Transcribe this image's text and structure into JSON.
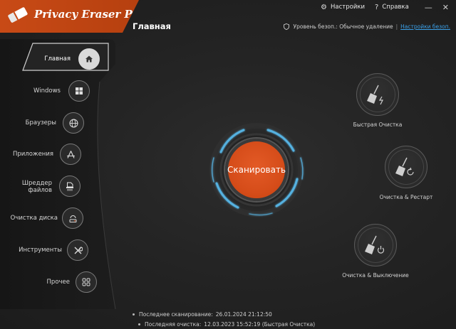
{
  "app": {
    "title": "Privacy Eraser Pro"
  },
  "topbar": {
    "settings_label": "Настройки",
    "help_label": "Справка",
    "minimize_glyph": "—",
    "close_glyph": "✕"
  },
  "page": {
    "title": "Главная"
  },
  "status": {
    "security_level": "Уровень безоп.: Обычное удаление",
    "separator": "|",
    "settings_link": "Настройки безоп."
  },
  "sidebar": {
    "items": [
      {
        "label": "Главная",
        "icon": "home-icon",
        "active": true
      },
      {
        "label": "Windows",
        "icon": "windows-icon"
      },
      {
        "label": "Браузеры",
        "icon": "globe-icon"
      },
      {
        "label": "Приложения",
        "icon": "apps-icon"
      },
      {
        "label_line1": "Шреддер",
        "label_line2": "файлов",
        "icon": "shredder-icon"
      },
      {
        "label": "Очистка диска",
        "icon": "disk-clean-icon"
      },
      {
        "label": "Инструменты",
        "icon": "tools-icon"
      },
      {
        "label": "Прочее",
        "icon": "grid-icon"
      }
    ]
  },
  "scan": {
    "label": "Сканировать"
  },
  "actions": [
    {
      "label": "Быстрая Очистка",
      "icon": "broom-lightning-icon"
    },
    {
      "label": "Очистка & Рестарт",
      "icon": "broom-restart-icon"
    },
    {
      "label": "Очистка & Выключение",
      "icon": "broom-power-icon"
    }
  ],
  "footer": {
    "last_scan_label": "Последнее сканирование:",
    "last_scan_value": "26.01.2024 21:12:50",
    "last_clean_label": "Последняя очистка:",
    "last_clean_value": "12.03.2023 15:52:19 (Быстрая Очистка)"
  },
  "colors": {
    "accent": "#d64d1a",
    "link": "#3ba0e8",
    "ring": "#4fa8d8",
    "background": "#242424"
  }
}
